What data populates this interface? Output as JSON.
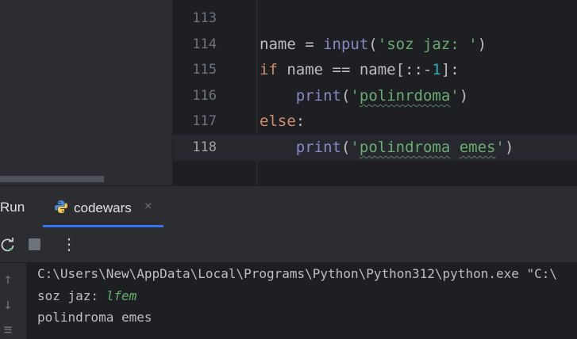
{
  "editor": {
    "lines": [
      {
        "num": "113",
        "current": false
      },
      {
        "num": "114",
        "current": false
      },
      {
        "num": "115",
        "current": false
      },
      {
        "num": "116",
        "current": false
      },
      {
        "num": "117",
        "current": false
      },
      {
        "num": "118",
        "current": true
      }
    ],
    "code": {
      "l114": {
        "var": "name",
        "op": " = ",
        "fn": "input",
        "open": "(",
        "str": "'soz jaz: '",
        "close": ")"
      },
      "l115": {
        "kw": "if",
        "rest1": " name == name[::-",
        "num": "1",
        "rest2": "]:"
      },
      "l116": {
        "indent": "    ",
        "fn": "print",
        "open": "(",
        "q1": "'",
        "word": "polinrdoma",
        "q2": "'",
        "close": ")"
      },
      "l117": {
        "kw": "else",
        "colon": ":"
      },
      "l118": {
        "indent": "    ",
        "fn": "print",
        "open": "(",
        "q1": "'",
        "w1": "polindroma",
        "sp": " ",
        "w2": "emes",
        "q2": "'",
        "close": ")"
      }
    }
  },
  "run_panel": {
    "title": "Run",
    "tab": {
      "label": "codewars",
      "close": "×",
      "icon": "python-icon"
    }
  },
  "toolbar": {
    "rerun_icon": "rerun-icon",
    "stop_icon": "stop-icon",
    "more": "⋮"
  },
  "side_tools": {
    "up": "↑",
    "down": "↓",
    "wrap": "≡"
  },
  "console": {
    "command": "C:\\Users\\New\\AppData\\Local\\Programs\\Python\\Python312\\python.exe \"C:\\",
    "prompt": "soz jaz: ",
    "input_value": "lfem",
    "output": "polindroma emes"
  },
  "colors": {
    "keyword": "#cf8e6d",
    "builtin": "#8888c6",
    "string": "#6aab73",
    "number": "#2aacb8",
    "accent": "#3574f0"
  }
}
